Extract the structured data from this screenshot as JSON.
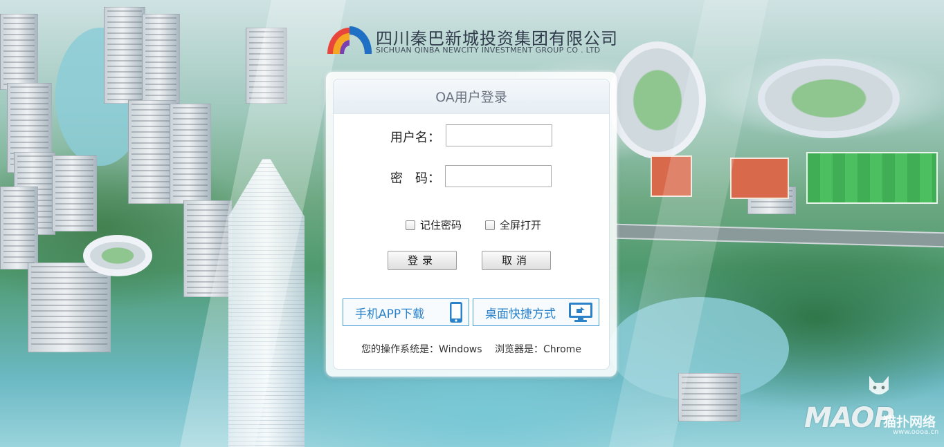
{
  "logo": {
    "name_cn": "四川秦巴新城投资集团有限公司",
    "name_en": "SICHUAN QINBA NEWCITY INVESTMENT GROUP CO . LTD"
  },
  "login": {
    "title": "OA用户登录",
    "username_label": "用户名：",
    "username_value": "",
    "password_label": "密　码：",
    "password_value": "",
    "remember_label": "记住密码",
    "fullscreen_label": "全屏打开",
    "login_button": "登录",
    "cancel_button": "取消",
    "app_download": "手机APP下载",
    "desktop_shortcut": "桌面快捷方式"
  },
  "system_info": {
    "os_label": "您的操作系统是：Windows",
    "browser_label": "浏览器是：Chrome"
  },
  "watermark": {
    "brand": "MAOP",
    "name_cn": "猫扑网络",
    "url": "www.oooa.cn"
  },
  "colors": {
    "accent_blue": "#2b82c9",
    "border_blue": "#4a9fd8",
    "panel_title": "#6b7480"
  },
  "icons": {
    "phone": "phone-icon",
    "desktop": "monitor-icon"
  }
}
